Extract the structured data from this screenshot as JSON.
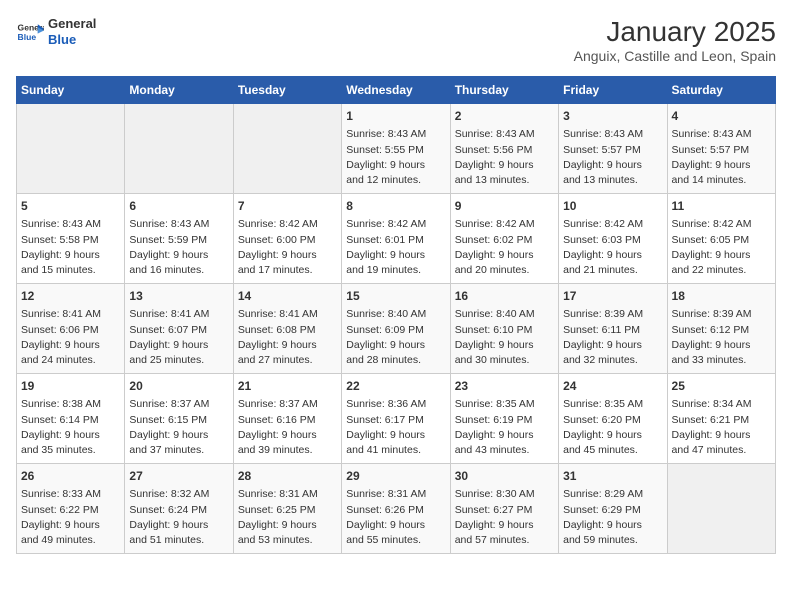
{
  "header": {
    "logo_line1": "General",
    "logo_line2": "Blue",
    "title": "January 2025",
    "subtitle": "Anguix, Castille and Leon, Spain"
  },
  "weekdays": [
    "Sunday",
    "Monday",
    "Tuesday",
    "Wednesday",
    "Thursday",
    "Friday",
    "Saturday"
  ],
  "weeks": [
    [
      {
        "day": "",
        "info": ""
      },
      {
        "day": "",
        "info": ""
      },
      {
        "day": "",
        "info": ""
      },
      {
        "day": "1",
        "info": "Sunrise: 8:43 AM\nSunset: 5:55 PM\nDaylight: 9 hours\nand 12 minutes."
      },
      {
        "day": "2",
        "info": "Sunrise: 8:43 AM\nSunset: 5:56 PM\nDaylight: 9 hours\nand 13 minutes."
      },
      {
        "day": "3",
        "info": "Sunrise: 8:43 AM\nSunset: 5:57 PM\nDaylight: 9 hours\nand 13 minutes."
      },
      {
        "day": "4",
        "info": "Sunrise: 8:43 AM\nSunset: 5:57 PM\nDaylight: 9 hours\nand 14 minutes."
      }
    ],
    [
      {
        "day": "5",
        "info": "Sunrise: 8:43 AM\nSunset: 5:58 PM\nDaylight: 9 hours\nand 15 minutes."
      },
      {
        "day": "6",
        "info": "Sunrise: 8:43 AM\nSunset: 5:59 PM\nDaylight: 9 hours\nand 16 minutes."
      },
      {
        "day": "7",
        "info": "Sunrise: 8:42 AM\nSunset: 6:00 PM\nDaylight: 9 hours\nand 17 minutes."
      },
      {
        "day": "8",
        "info": "Sunrise: 8:42 AM\nSunset: 6:01 PM\nDaylight: 9 hours\nand 19 minutes."
      },
      {
        "day": "9",
        "info": "Sunrise: 8:42 AM\nSunset: 6:02 PM\nDaylight: 9 hours\nand 20 minutes."
      },
      {
        "day": "10",
        "info": "Sunrise: 8:42 AM\nSunset: 6:03 PM\nDaylight: 9 hours\nand 21 minutes."
      },
      {
        "day": "11",
        "info": "Sunrise: 8:42 AM\nSunset: 6:05 PM\nDaylight: 9 hours\nand 22 minutes."
      }
    ],
    [
      {
        "day": "12",
        "info": "Sunrise: 8:41 AM\nSunset: 6:06 PM\nDaylight: 9 hours\nand 24 minutes."
      },
      {
        "day": "13",
        "info": "Sunrise: 8:41 AM\nSunset: 6:07 PM\nDaylight: 9 hours\nand 25 minutes."
      },
      {
        "day": "14",
        "info": "Sunrise: 8:41 AM\nSunset: 6:08 PM\nDaylight: 9 hours\nand 27 minutes."
      },
      {
        "day": "15",
        "info": "Sunrise: 8:40 AM\nSunset: 6:09 PM\nDaylight: 9 hours\nand 28 minutes."
      },
      {
        "day": "16",
        "info": "Sunrise: 8:40 AM\nSunset: 6:10 PM\nDaylight: 9 hours\nand 30 minutes."
      },
      {
        "day": "17",
        "info": "Sunrise: 8:39 AM\nSunset: 6:11 PM\nDaylight: 9 hours\nand 32 minutes."
      },
      {
        "day": "18",
        "info": "Sunrise: 8:39 AM\nSunset: 6:12 PM\nDaylight: 9 hours\nand 33 minutes."
      }
    ],
    [
      {
        "day": "19",
        "info": "Sunrise: 8:38 AM\nSunset: 6:14 PM\nDaylight: 9 hours\nand 35 minutes."
      },
      {
        "day": "20",
        "info": "Sunrise: 8:37 AM\nSunset: 6:15 PM\nDaylight: 9 hours\nand 37 minutes."
      },
      {
        "day": "21",
        "info": "Sunrise: 8:37 AM\nSunset: 6:16 PM\nDaylight: 9 hours\nand 39 minutes."
      },
      {
        "day": "22",
        "info": "Sunrise: 8:36 AM\nSunset: 6:17 PM\nDaylight: 9 hours\nand 41 minutes."
      },
      {
        "day": "23",
        "info": "Sunrise: 8:35 AM\nSunset: 6:19 PM\nDaylight: 9 hours\nand 43 minutes."
      },
      {
        "day": "24",
        "info": "Sunrise: 8:35 AM\nSunset: 6:20 PM\nDaylight: 9 hours\nand 45 minutes."
      },
      {
        "day": "25",
        "info": "Sunrise: 8:34 AM\nSunset: 6:21 PM\nDaylight: 9 hours\nand 47 minutes."
      }
    ],
    [
      {
        "day": "26",
        "info": "Sunrise: 8:33 AM\nSunset: 6:22 PM\nDaylight: 9 hours\nand 49 minutes."
      },
      {
        "day": "27",
        "info": "Sunrise: 8:32 AM\nSunset: 6:24 PM\nDaylight: 9 hours\nand 51 minutes."
      },
      {
        "day": "28",
        "info": "Sunrise: 8:31 AM\nSunset: 6:25 PM\nDaylight: 9 hours\nand 53 minutes."
      },
      {
        "day": "29",
        "info": "Sunrise: 8:31 AM\nSunset: 6:26 PM\nDaylight: 9 hours\nand 55 minutes."
      },
      {
        "day": "30",
        "info": "Sunrise: 8:30 AM\nSunset: 6:27 PM\nDaylight: 9 hours\nand 57 minutes."
      },
      {
        "day": "31",
        "info": "Sunrise: 8:29 AM\nSunset: 6:29 PM\nDaylight: 9 hours\nand 59 minutes."
      },
      {
        "day": "",
        "info": ""
      }
    ]
  ]
}
